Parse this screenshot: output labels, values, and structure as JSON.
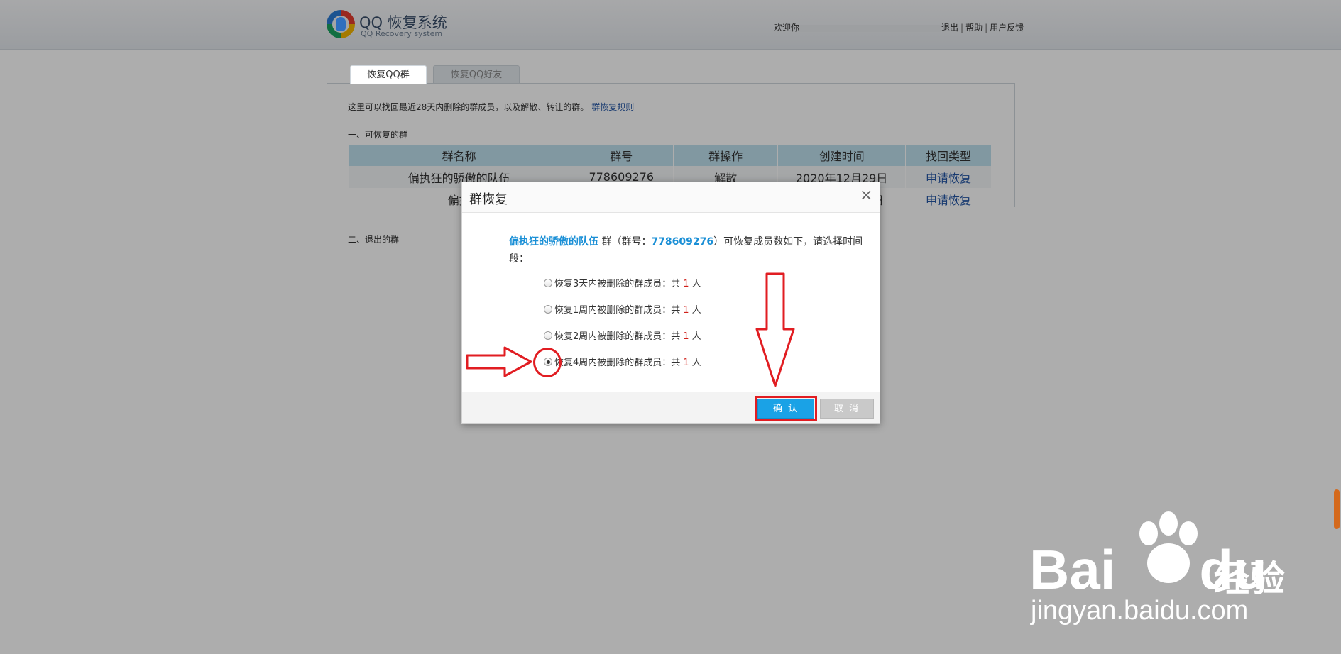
{
  "header": {
    "logo_title": "QQ 恢复系统",
    "logo_subtitle": "QQ Recovery system",
    "welcome": "欢迎你",
    "logout": "退出",
    "help": "帮助",
    "feedback": "用户反馈",
    "separator": "|"
  },
  "tabs": [
    {
      "label": "恢复QQ群",
      "active": true
    },
    {
      "label": "恢复QQ好友",
      "active": false
    }
  ],
  "main": {
    "intro": "这里可以找回最近28天内删除的群成员，以及解散、转让的群。",
    "intro_link": "群恢复规则",
    "section1": "一、可恢复的群",
    "section2": "二、退出的群"
  },
  "table": {
    "headers": [
      "群名称",
      "群号",
      "群操作",
      "创建时间",
      "找回类型"
    ],
    "rows": [
      {
        "name": "偏执狂的骄傲的队伍",
        "id": "778609276",
        "op": "解散",
        "created": "2020年12月29日",
        "action": "申请恢复"
      },
      {
        "name": "偏执",
        "id": "",
        "op": "",
        "created": "日",
        "action": "申请恢复"
      }
    ]
  },
  "dialog": {
    "title": "群恢复",
    "close": "×",
    "group_name": "偏执狂的骄傲的队伍",
    "desc_mid": " 群（群号：",
    "group_id": "778609276",
    "desc_end": "）可恢复成员数如下，请选择时间段：",
    "options": [
      {
        "label": "恢复3天内被删除的群成员：共",
        "count": "1",
        "unit": "人",
        "checked": false
      },
      {
        "label": "恢复1周内被删除的群成员：共",
        "count": "1",
        "unit": "人",
        "checked": false
      },
      {
        "label": "恢复2周内被删除的群成员：共",
        "count": "1",
        "unit": "人",
        "checked": false
      },
      {
        "label": "恢复4周内被删除的群成员：共",
        "count": "1",
        "unit": "人",
        "checked": true
      }
    ],
    "confirm": "确 认",
    "cancel": "取 消"
  },
  "watermark": {
    "brand": "Bai",
    "brand_tail": "du",
    "cn": "经验",
    "url": "jingyan.baidu.com"
  },
  "colors": {
    "accent_blue": "#1aa2e6",
    "link_blue": "#2456a6",
    "annotation_red": "#e11d22",
    "count_red": "#d0201a",
    "table_header_bg": "#bfe0ee"
  }
}
